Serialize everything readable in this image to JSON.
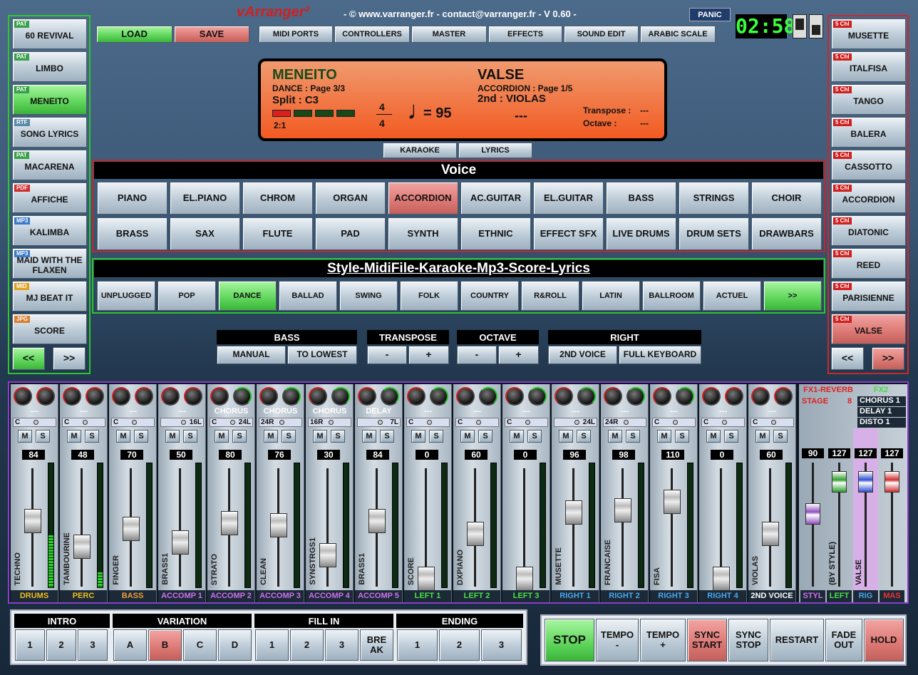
{
  "app": {
    "logo": "vArranger²",
    "info": "- © www.varranger.fr - contact@varranger.fr - V 0.60 -",
    "panic": "PANIC",
    "clock": "02:58"
  },
  "top": {
    "load": "LOAD",
    "save": "SAVE",
    "menu": [
      "MIDI PORTS",
      "CONTROLLERS",
      "MASTER",
      "EFFECTS",
      "SOUND EDIT",
      "ARABIC SCALE"
    ]
  },
  "left": {
    "items": [
      {
        "tag": "PAT",
        "tagcolor": "#3aa04a",
        "label": "60 REVIVAL",
        "active": false
      },
      {
        "tag": "PAT",
        "tagcolor": "#3aa04a",
        "label": "LIMBO",
        "active": false
      },
      {
        "tag": "PAT",
        "tagcolor": "#3aa04a",
        "label": "MENEITO",
        "active": true
      },
      {
        "tag": "RTF",
        "tagcolor": "#5a8aa8",
        "label": "SONG LYRICS",
        "active": false
      },
      {
        "tag": "PAT",
        "tagcolor": "#3aa04a",
        "label": "MACARENA",
        "active": false
      },
      {
        "tag": "PDF",
        "tagcolor": "#d03030",
        "label": "AFFICHE",
        "active": false
      },
      {
        "tag": "MP3",
        "tagcolor": "#3a7ac8",
        "label": "KALIMBA",
        "active": false
      },
      {
        "tag": "MP3",
        "tagcolor": "#3a7ac8",
        "label": "MAID WITH THE FLAXEN",
        "active": false
      },
      {
        "tag": "MID",
        "tagcolor": "#e0a020",
        "label": "MJ BEAT IT",
        "active": false
      },
      {
        "tag": "JPG",
        "tagcolor": "#d88030",
        "label": "SCORE",
        "active": false
      }
    ],
    "prev": "<<",
    "next": ">>"
  },
  "right": {
    "items": [
      {
        "tag": "5 Chl",
        "label": "MUSETTE",
        "active": false
      },
      {
        "tag": "5 Chl",
        "label": "ITALFISA",
        "active": false
      },
      {
        "tag": "5 Chl",
        "label": "TANGO",
        "active": false
      },
      {
        "tag": "5 Chl",
        "label": "BALERA",
        "active": false
      },
      {
        "tag": "5 Chl",
        "label": "CASSOTTO",
        "active": false
      },
      {
        "tag": "5 Chl",
        "label": "ACCORDION",
        "active": false
      },
      {
        "tag": "5 Chl",
        "label": "DIATONIC",
        "active": false
      },
      {
        "tag": "5 Chl",
        "label": "REED",
        "active": false
      },
      {
        "tag": "5 Chl",
        "label": "PARISIENNE",
        "active": false
      },
      {
        "tag": "5 Chl",
        "label": "VALSE",
        "active": true
      }
    ],
    "prev": "<<",
    "next": ">>"
  },
  "display": {
    "style_name": "MENEITO",
    "style_page": "DANCE : Page 3/3",
    "split": "Split : C3",
    "var": "2:1",
    "ts_top": "4",
    "ts_bottom": "4",
    "tempo": "= 95",
    "voice_name": "VALSE",
    "voice_page": "ACCORDION : Page 1/5",
    "second": "2nd : VIOLAS",
    "chord": "---",
    "transpose_label": "Transpose :",
    "transpose_val": "---",
    "octave_label": "Octave :",
    "octave_val": "---",
    "karaoke": "KARAOKE",
    "lyrics": "LYRICS"
  },
  "voice": {
    "title": "Voice",
    "buttons": [
      "PIANO",
      "EL.PIANO",
      "CHROM",
      "ORGAN",
      "ACCORDION",
      "AC.GUITAR",
      "EL.GUITAR",
      "BASS",
      "STRINGS",
      "CHOIR",
      "BRASS",
      "SAX",
      "FLUTE",
      "PAD",
      "SYNTH",
      "ETHNIC",
      "EFFECT SFX",
      "LIVE DRUMS",
      "DRUM SETS",
      "DRAWBARS"
    ],
    "selected": 4
  },
  "style": {
    "title": "Style-MidiFile-Karaoke-Mp3-Score-Lyrics",
    "buttons": [
      "UNPLUGGED",
      "POP",
      "DANCE",
      "BALLAD",
      "SWING",
      "FOLK",
      "COUNTRY",
      "R&ROLL",
      "LATIN",
      "BALLROOM",
      "ACTUEL",
      ">>"
    ],
    "selected": 2
  },
  "controls": {
    "bass": "BASS",
    "manual": "MANUAL",
    "tolowest": "TO LOWEST",
    "transpose": "TRANSPOSE",
    "minus": "-",
    "plus": "+",
    "octave": "OCTAVE",
    "right": "RIGHT",
    "second_voice": "2ND VOICE",
    "full_keyboard": "FULL KEYBOARD"
  },
  "mixer": {
    "channels": [
      {
        "name": "DRUMS",
        "color": "#f0c020",
        "voice": "TECHNO",
        "fx": "---",
        "cc": "C",
        "pan": "",
        "val": "84",
        "fader": 0.62,
        "level": 0.42,
        "k1": "r",
        "k2": "r"
      },
      {
        "name": "PERC",
        "color": "#f0c020",
        "voice": "TAMBOURINE",
        "fx": "---",
        "cc": "C",
        "pan": "",
        "val": "48",
        "fader": 0.38,
        "level": 0.12,
        "k1": "r",
        "k2": "r"
      },
      {
        "name": "BASS",
        "color": "#f0a040",
        "voice": "FINGER",
        "fx": "---",
        "cc": "C",
        "pan": "",
        "val": "70",
        "fader": 0.55,
        "level": 0,
        "k1": "r",
        "k2": "r"
      },
      {
        "name": "ACCOMP 1",
        "color": "#d070f0",
        "voice": "BRASS1",
        "fx": "---",
        "cc": "",
        "pan": "16L",
        "val": "50",
        "fader": 0.42,
        "level": 0,
        "k1": "r",
        "k2": "r"
      },
      {
        "name": "ACCOMP 2",
        "color": "#d070f0",
        "voice": "STRATO",
        "fx": "CHORUS",
        "cc": "C",
        "pan": "24L",
        "val": "80",
        "fader": 0.6,
        "level": 0,
        "k1": "r",
        "k2": "g"
      },
      {
        "name": "ACCOMP 3",
        "color": "#d070f0",
        "voice": "CLEAN",
        "fx": "CHORUS",
        "cc": "24R",
        "pan": "",
        "val": "76",
        "fader": 0.58,
        "level": 0,
        "k1": "r",
        "k2": "g"
      },
      {
        "name": "ACCOMP 4",
        "color": "#d070f0",
        "voice": "SYNSTRGS1",
        "fx": "CHORUS",
        "cc": "16R",
        "pan": "",
        "val": "30",
        "fader": 0.3,
        "level": 0,
        "k1": "r",
        "k2": "g"
      },
      {
        "name": "ACCOMP 5",
        "color": "#d070f0",
        "voice": "BRASS1",
        "fx": "DELAY",
        "cc": "",
        "pan": "7L",
        "val": "84",
        "fader": 0.62,
        "level": 0,
        "k1": "r",
        "k2": "g"
      },
      {
        "name": "LEFT 1",
        "color": "#4ce04c",
        "voice": "SCORE",
        "fx": "---",
        "cc": "C",
        "pan": "",
        "val": "0",
        "fader": 0.08,
        "level": 0,
        "k1": "r",
        "k2": "g"
      },
      {
        "name": "LEFT 2",
        "color": "#4ce04c",
        "voice": "DXPIANO",
        "fx": "---",
        "cc": "C",
        "pan": "",
        "val": "60",
        "fader": 0.5,
        "level": 0,
        "k1": "r",
        "k2": "g"
      },
      {
        "name": "LEFT 3",
        "color": "#4ce04c",
        "voice": "",
        "fx": "---",
        "cc": "C",
        "pan": "",
        "val": "0",
        "fader": 0.08,
        "level": 0,
        "k1": "r",
        "k2": "g"
      },
      {
        "name": "RIGHT 1",
        "color": "#4aa8f0",
        "voice": "MUSETTE",
        "fx": "---",
        "cc": "",
        "pan": "24L",
        "val": "96",
        "fader": 0.7,
        "level": 0,
        "k1": "r",
        "k2": "g"
      },
      {
        "name": "RIGHT 2",
        "color": "#4aa8f0",
        "voice": "FRANCAISE",
        "fx": "---",
        "cc": "24R",
        "pan": "",
        "val": "98",
        "fader": 0.72,
        "level": 0,
        "k1": "r",
        "k2": "g"
      },
      {
        "name": "RIGHT 3",
        "color": "#4aa8f0",
        "voice": "FISA",
        "fx": "---",
        "cc": "C",
        "pan": "",
        "val": "110",
        "fader": 0.8,
        "level": 0,
        "k1": "r",
        "k2": "g"
      },
      {
        "name": "RIGHT 4",
        "color": "#4aa8f0",
        "voice": "",
        "fx": "---",
        "cc": "C",
        "pan": "",
        "val": "0",
        "fader": 0.08,
        "level": 0,
        "k1": "r",
        "k2": "r"
      },
      {
        "name": "2ND VOICE",
        "color": "#ffffff",
        "voice": "VIOLAS",
        "fx": "---",
        "cc": "C",
        "pan": "",
        "val": "60",
        "fader": 0.5,
        "level": 0,
        "k1": "r",
        "k2": "r"
      }
    ],
    "fx1": "FX1-REVERB",
    "stage": "STAGE",
    "stage_val": "8",
    "fx2": "FX2",
    "fx2_items": [
      "CHORUS 1",
      "DELAY 1",
      "DISTO 1"
    ],
    "masters": [
      {
        "name": "STYL",
        "color": "#d070f0",
        "val": "90",
        "fader": 0.62,
        "cap": "#9050c0",
        "voice": ""
      },
      {
        "name": "LEFT",
        "color": "#4ce04c",
        "val": "127",
        "fader": 0.92,
        "cap": "#30a030",
        "voice": "(BY STYLE)"
      },
      {
        "name": "RIG",
        "color": "#4aa8f0",
        "val": "127",
        "fader": 0.92,
        "cap": "#3050d0",
        "voice": "VALSE"
      },
      {
        "name": "MAS",
        "color": "#f03030",
        "val": "127",
        "fader": 0.92,
        "cap": "#d03030",
        "voice": ""
      }
    ],
    "mute": "M",
    "solo": "S"
  },
  "bottom": {
    "intro": "INTRO",
    "variation": "VARIATION",
    "fillin": "FILL IN",
    "ending": "ENDING",
    "intro_btns": [
      "1",
      "2",
      "3"
    ],
    "var_btns": [
      "A",
      "B",
      "C",
      "D"
    ],
    "var_selected": 1,
    "fill_btns": [
      "1",
      "2",
      "3",
      "BRE AK"
    ],
    "end_btns": [
      "1",
      "2",
      "3"
    ],
    "transport": [
      {
        "label": "STOP",
        "style": "green"
      },
      {
        "label": "TEMPO -",
        "style": ""
      },
      {
        "label": "TEMPO +",
        "style": ""
      },
      {
        "label": "SYNC START",
        "style": "red"
      },
      {
        "label": "SYNC STOP",
        "style": ""
      },
      {
        "label": "RESTART",
        "style": ""
      },
      {
        "label": "FADE OUT",
        "style": ""
      },
      {
        "label": "HOLD",
        "style": "red"
      }
    ]
  }
}
